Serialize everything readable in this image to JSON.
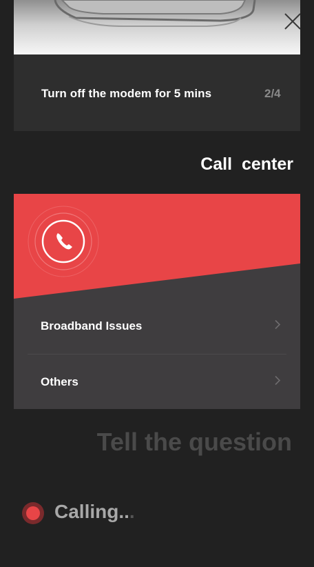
{
  "step_card": {
    "instruction": "Turn off the modem for 5 mins",
    "progress_label": "2/4",
    "hero_image": "modem-device"
  },
  "close_icon": "close-icon",
  "section": {
    "title": "Call  center"
  },
  "call_card": {
    "phone_icon": "phone-icon",
    "accent_color": "#e84547",
    "items": [
      {
        "label": "Broadband Issues",
        "icon": "chevron-right-icon"
      },
      {
        "label": "Others",
        "icon": "chevron-right-icon"
      }
    ]
  },
  "prompt": {
    "text": "Tell the question"
  },
  "status": {
    "text_main": "Calling..",
    "text_dim": ".",
    "indicator_color": "#e84547"
  }
}
